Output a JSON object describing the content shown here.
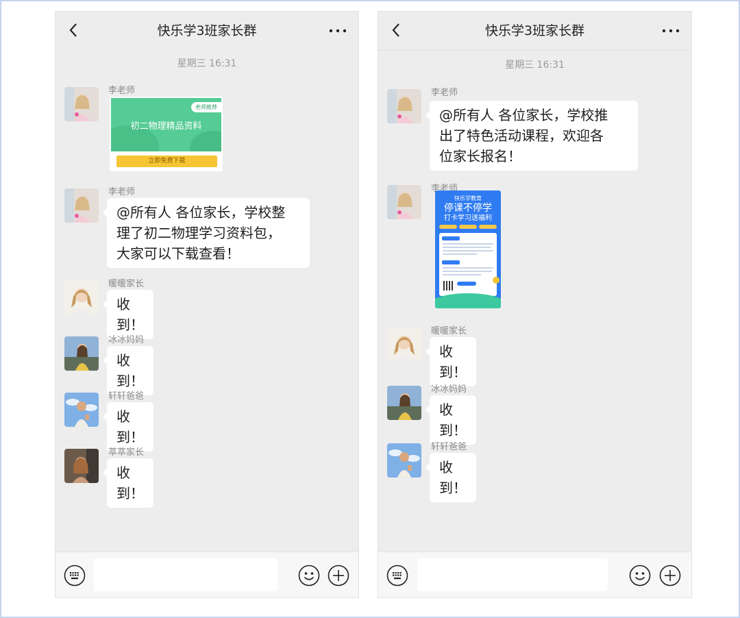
{
  "left": {
    "title": "快乐学3班家长群",
    "timestamp": "星期三 16:31",
    "card": {
      "sender": "李老师",
      "tag": "老师推荐",
      "title": "初二物理精品资料",
      "button": "立即免费下载"
    },
    "text_message": {
      "sender": "李老师",
      "lines": [
        "@所有人 各位家长，学校整",
        "理了初二物理学习资料包，",
        "大家可以下载查看！"
      ]
    },
    "replies": [
      {
        "sender": "暖暖家长",
        "text": "收到！"
      },
      {
        "sender": "冰冰妈妈",
        "text": "收到！"
      },
      {
        "sender": "轩轩爸爸",
        "text": "收到！"
      },
      {
        "sender": "萃萃家长",
        "text": "收到！"
      }
    ]
  },
  "right": {
    "title": "快乐学3班家长群",
    "timestamp": "星期三 16:31",
    "text_message": {
      "sender": "李老师",
      "lines": [
        "@所有人 各位家长，学校推",
        "出了特色活动课程，欢迎各",
        "位家长报名！"
      ]
    },
    "poster": {
      "sender": "李老师",
      "brand": "快乐学教育",
      "headline": "停课不停学",
      "subline": "打卡学习送福利"
    },
    "replies": [
      {
        "sender": "暖暖家长",
        "text": "收到！"
      },
      {
        "sender": "冰冰妈妈",
        "text": "收到！"
      },
      {
        "sender": "轩轩爸爸",
        "text": "收到！"
      }
    ]
  },
  "colors": {
    "chat_background": "#ededed",
    "bubble": "#ffffff",
    "card_green": "#55cc95",
    "download_button": "#f6c534",
    "poster_blue": "#2f7bf2"
  },
  "icons": {
    "back": "chevron-left-icon",
    "more": "more-dots-icon",
    "keyboard": "keyboard-icon",
    "emoji": "smiley-icon",
    "add": "plus-circle-icon"
  }
}
